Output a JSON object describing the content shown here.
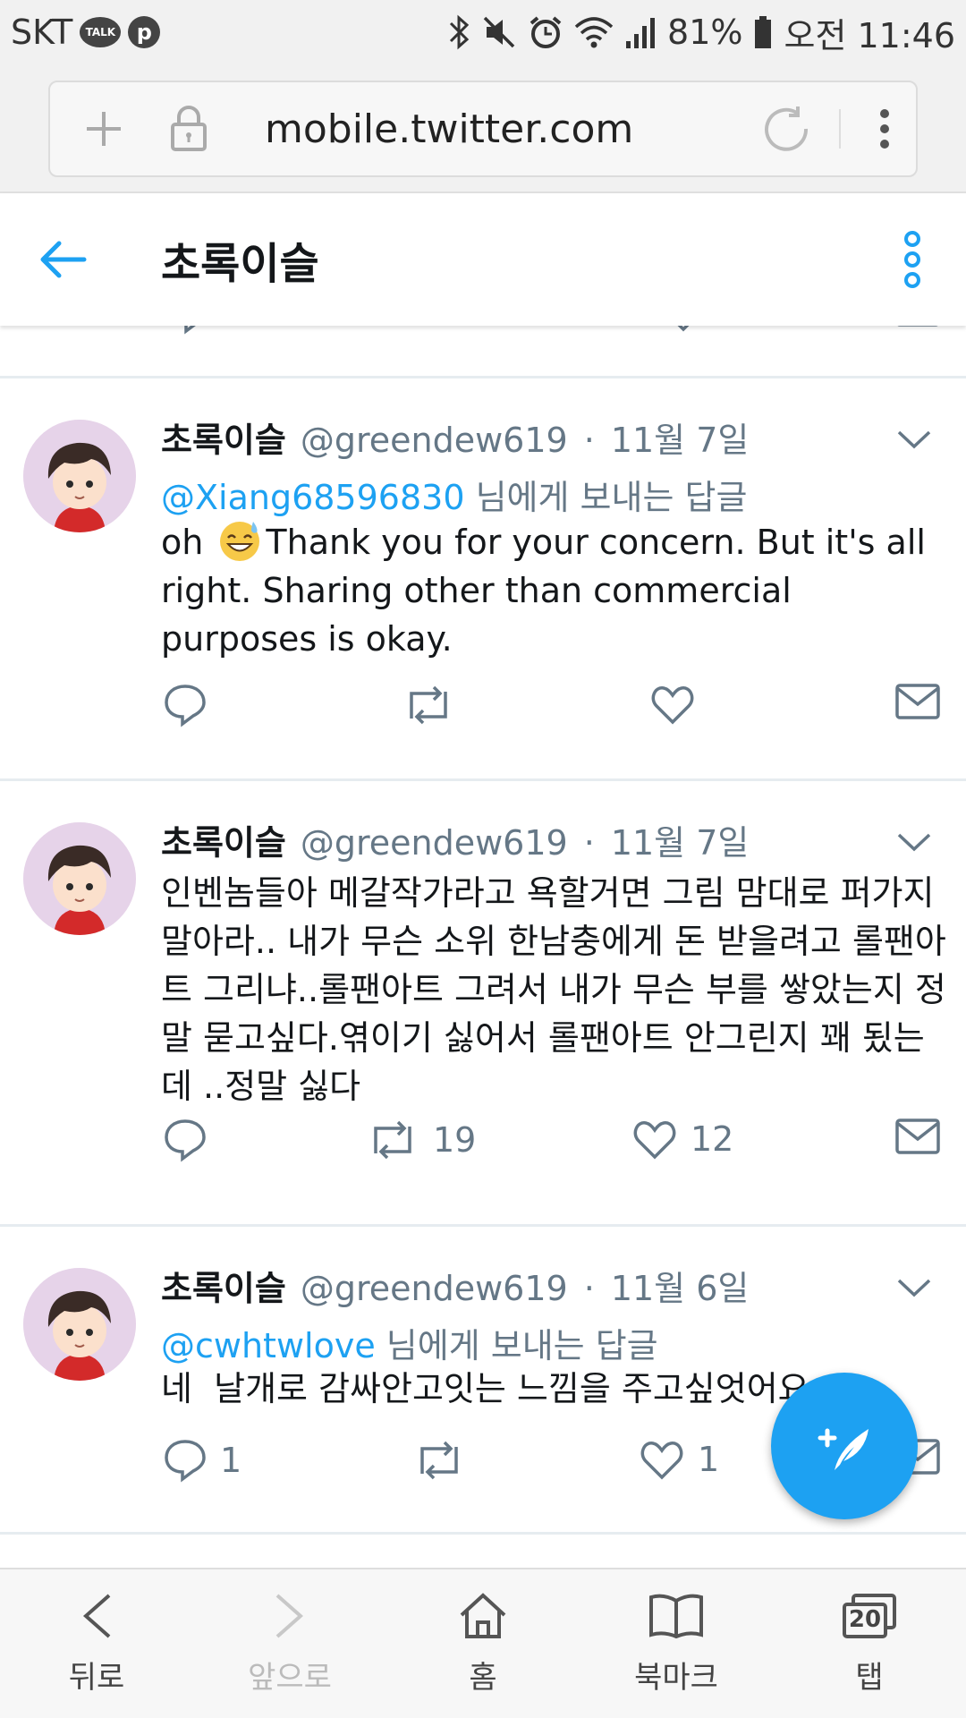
{
  "status_bar": {
    "carrier": "SKT",
    "talk_badge": "TALK",
    "pin_badge": "p",
    "battery": "81%",
    "time": "오전 11:46",
    "icons": [
      "bluetooth-icon",
      "mute-icon",
      "alarm-icon",
      "wifi-icon",
      "signal-icon",
      "battery-icon"
    ]
  },
  "browser": {
    "url": "mobile.twitter.com"
  },
  "header": {
    "title": "초록이슬"
  },
  "tweets": [
    {
      "name": "초록이슬",
      "handle": "@greendew619",
      "separator": "·",
      "date": "11월 7일",
      "reply_mention": "@Xiang68596830",
      "reply_suffix": " 님에게 보내는 답글",
      "text_before_emoji": "oh ",
      "emoji": "grinning-sweat-emoji",
      "text_after_emoji": "Thank you for your concern. But it's all right. Sharing other than commercial purposes is okay.",
      "reply_count": "",
      "retweet_count": "",
      "like_count": ""
    },
    {
      "name": "초록이슬",
      "handle": "@greendew619",
      "separator": "·",
      "date": "11월 7일",
      "text": "인벤놈들아 메갈작가라고 욕할거면 그림 맘대로 퍼가지말아라.. 내가 무슨 소위 한남충에게 돈 받을려고 롤팬아트 그리냐..롤팬아트 그려서 내가 무슨 부를 쌓았는지 정말 묻고싶다.엮이기 싫어서 롤팬아트 안그린지 꽤 됬는데 ..정말 싫다",
      "reply_count": "",
      "retweet_count": "19",
      "like_count": "12"
    },
    {
      "name": "초록이슬",
      "handle": "@greendew619",
      "separator": "·",
      "date": "11월 6일",
      "reply_mention": "@cwhtwlove",
      "reply_suffix": " 님에게 보내는 답글",
      "text": "네  날개로 감싸안고잇는 느낌을 주고싶엇어요",
      "reply_count": "1",
      "retweet_count": "",
      "like_count": "1"
    }
  ],
  "bottom_nav": {
    "back": "뒤로",
    "forward": "앞으로",
    "home": "홈",
    "bookmarks": "북마크",
    "tabs": "탭",
    "tab_count": "20"
  },
  "colors": {
    "twitter_blue": "#1da1f2",
    "secondary_text": "#657786",
    "divider": "#e6ecf0"
  }
}
